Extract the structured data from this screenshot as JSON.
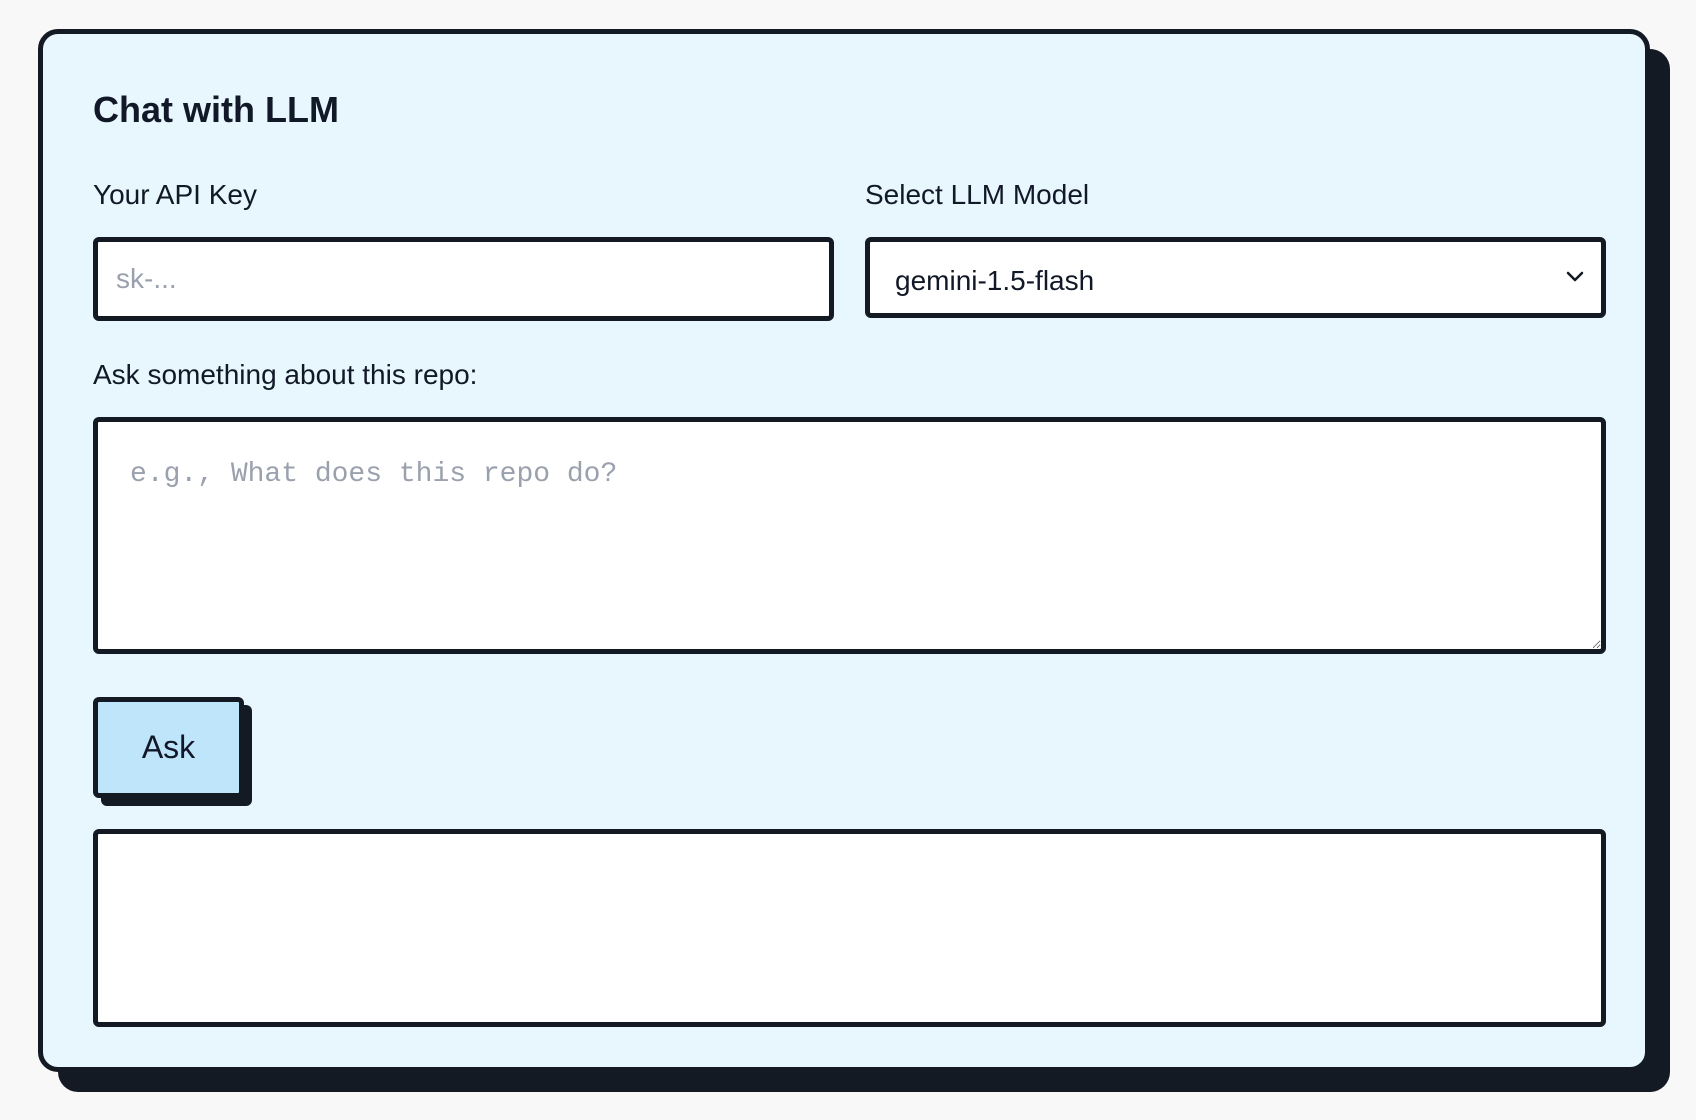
{
  "card": {
    "title": "Chat with LLM"
  },
  "api_key": {
    "label": "Your API Key",
    "placeholder": "sk-...",
    "value": ""
  },
  "model": {
    "label": "Select LLM Model",
    "selected": "gemini-1.5-flash",
    "icon": "chevron-down-icon"
  },
  "question": {
    "label": "Ask something about this repo:",
    "placeholder": "e.g., What does this repo do?",
    "value": ""
  },
  "ask_button": {
    "label": "Ask"
  },
  "response": {
    "text": ""
  },
  "colors": {
    "card_background": "#e8f6fd",
    "border": "#141a23",
    "button_background": "#bfe5fa",
    "placeholder": "#9aa1ad"
  }
}
